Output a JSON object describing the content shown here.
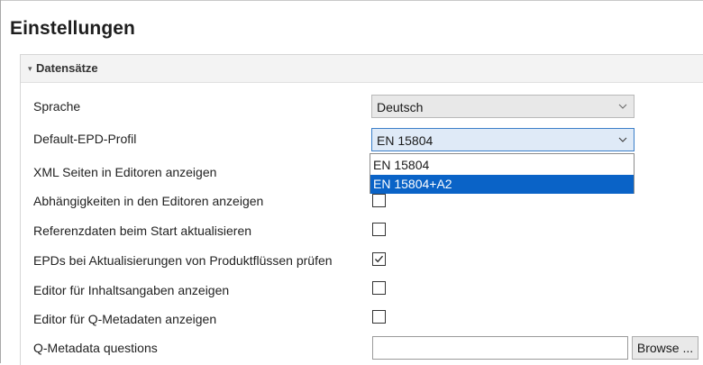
{
  "page": {
    "title": "Einstellungen"
  },
  "section": {
    "title": "Datensätze",
    "toggle_icon": "caret-down-icon",
    "expanded": true
  },
  "settings": {
    "language": {
      "label": "Sprache",
      "value": "Deutsch"
    },
    "epd_profile": {
      "label": "Default-EPD-Profil",
      "value": "EN 15804",
      "options": [
        "EN 15804",
        "EN 15804+A2"
      ],
      "highlighted_option": "EN 15804+A2"
    },
    "show_xml_pages": {
      "label": "XML Seiten in Editoren anzeigen"
    },
    "show_dependencies": {
      "label": "Abhängigkeiten in den Editoren anzeigen",
      "checked": false
    },
    "update_reference_data": {
      "label": "Referenzdaten beim Start aktualisieren",
      "checked": false
    },
    "check_epds_on_update": {
      "label": "EPDs bei Aktualisierungen von Produktflüssen prüfen",
      "checked": true
    },
    "show_content_editor": {
      "label": "Editor für Inhaltsangaben anzeigen",
      "checked": false
    },
    "show_q_metadata_editor": {
      "label": "Editor für Q-Metadaten anzeigen",
      "checked": false
    },
    "q_metadata_questions": {
      "label": "Q-Metadata questions",
      "value": "",
      "browse_label": "Browse ..."
    }
  },
  "colors": {
    "accent": "#0a63c7",
    "focus_border": "#3b7fc9",
    "combo_focus_bg": "#dfeaf7",
    "header_bg": "#f3f3f3"
  }
}
